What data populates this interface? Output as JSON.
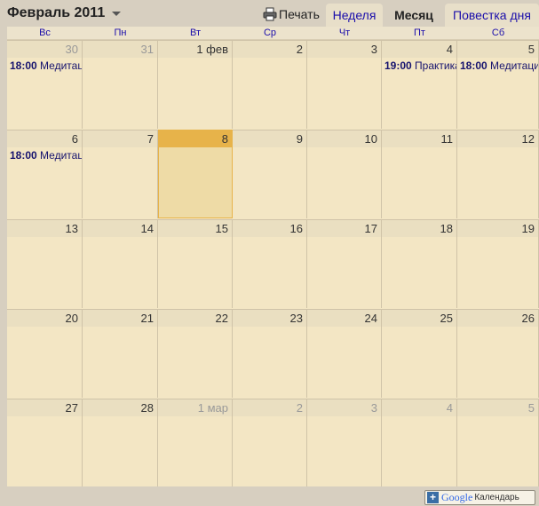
{
  "header": {
    "month_title": "Февраль 2011",
    "print_label": "Печать",
    "tabs": [
      {
        "label": "Неделя"
      },
      {
        "label": "Месяц"
      },
      {
        "label": "Повестка дня"
      }
    ]
  },
  "weekdays": [
    "Вс",
    "Пн",
    "Вт",
    "Ср",
    "Чт",
    "Пт",
    "Сб"
  ],
  "weeks": [
    {
      "days": [
        {
          "label": "30",
          "other": true,
          "event": {
            "time": "18:00",
            "title": "Медитация"
          }
        },
        {
          "label": "31",
          "other": true
        },
        {
          "label": "1 фев",
          "other": false
        },
        {
          "label": "2",
          "other": false
        },
        {
          "label": "3",
          "other": false
        },
        {
          "label": "4",
          "other": false,
          "event": {
            "time": "19:00",
            "title": "Практика"
          }
        },
        {
          "label": "5",
          "other": false,
          "event": {
            "time": "18:00",
            "title": "Медитация"
          }
        }
      ]
    },
    {
      "days": [
        {
          "label": "6",
          "other": false,
          "event": {
            "time": "18:00",
            "title": "Медитация"
          }
        },
        {
          "label": "7",
          "other": false
        },
        {
          "label": "8",
          "other": false,
          "today": true
        },
        {
          "label": "9",
          "other": false
        },
        {
          "label": "10",
          "other": false
        },
        {
          "label": "11",
          "other": false
        },
        {
          "label": "12",
          "other": false
        }
      ]
    },
    {
      "days": [
        {
          "label": "13"
        },
        {
          "label": "14"
        },
        {
          "label": "15"
        },
        {
          "label": "16"
        },
        {
          "label": "17"
        },
        {
          "label": "18"
        },
        {
          "label": "19"
        }
      ]
    },
    {
      "days": [
        {
          "label": "20"
        },
        {
          "label": "21"
        },
        {
          "label": "22"
        },
        {
          "label": "23"
        },
        {
          "label": "24"
        },
        {
          "label": "25"
        },
        {
          "label": "26"
        }
      ]
    },
    {
      "days": [
        {
          "label": "27"
        },
        {
          "label": "28"
        },
        {
          "label": "1 мар",
          "other": true
        },
        {
          "label": "2",
          "other": true
        },
        {
          "label": "3",
          "other": true
        },
        {
          "label": "4",
          "other": true
        },
        {
          "label": "5",
          "other": true
        }
      ]
    }
  ],
  "footer": {
    "brand": "Google",
    "product": "Календарь"
  },
  "colors": {
    "today_accent": "#e7b34a",
    "link": "#1a0dab",
    "event_text": "#16136e"
  }
}
